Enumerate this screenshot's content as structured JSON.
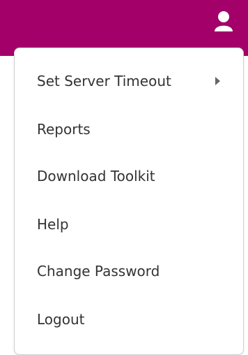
{
  "header": {
    "icon": "user-icon",
    "accent_color": "#a3006a"
  },
  "menu": {
    "items": [
      {
        "label": "Set Server Timeout",
        "has_submenu": true,
        "submenu_icon": "chevron-right-icon"
      },
      {
        "label": "Reports"
      },
      {
        "label": "Download Toolkit"
      },
      {
        "label": "Help"
      },
      {
        "label": "Change Password"
      },
      {
        "label": "Logout"
      }
    ]
  }
}
